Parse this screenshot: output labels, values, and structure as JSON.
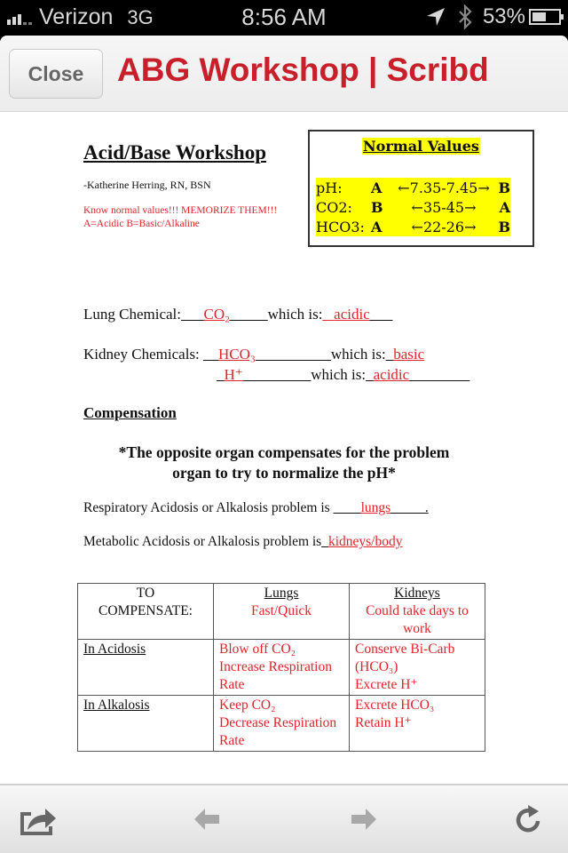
{
  "status_bar": {
    "carrier": "Verizon",
    "network": "3G",
    "time": "8:56 AM",
    "battery_percent": "53%",
    "battery_level": 0.53,
    "icons": [
      "signal-icon",
      "location-icon",
      "bluetooth-icon",
      "battery-icon"
    ]
  },
  "nav": {
    "close_label": "Close",
    "title": "ABG Workshop | Scribd",
    "title_color": "#c8202b"
  },
  "doc": {
    "title": "Acid/Base Workshop",
    "author": "-Katherine Herring, RN, BSN",
    "memo_line1": "Know normal values!!! MEMORIZE THEM!!!",
    "memo_line2": "A=Acidic  B=Basic/Alkaline",
    "normal_values": {
      "title": "Normal Values",
      "rows": [
        {
          "label": "pH:",
          "low": "A",
          "range": "←7.35-7.45→",
          "high": "B"
        },
        {
          "label": "CO2:",
          "low": "B",
          "range": "←35-45→",
          "high": "A"
        },
        {
          "label": "HCO3:",
          "low": "A",
          "range": "←22-26→",
          "high": "B"
        }
      ]
    },
    "lung": {
      "label": "Lung Chemical:",
      "blank_pre": "___",
      "answer": "CO₂",
      "blank_post": "_____",
      "which_is": "which is:",
      "which_blank_pre": "_  ",
      "which_answer": "acidic",
      "which_blank_post": "___"
    },
    "kidney": {
      "label": "Kidney Chemicals: ",
      "blank_pre": "__",
      "answer1": "HCO₃",
      "blank_mid1": "__________",
      "which_is": "which is:",
      "which_pre": "_",
      "answer1_type": "basic",
      "blank_pre2": "_",
      "answer2": "H⁺",
      "blank_mid2": "_________",
      "answer2_type": "acidic",
      "which_post2": "________"
    },
    "compensation_heading": "Compensation",
    "rule_line1": "*The opposite organ compensates for the problem",
    "rule_line2": "organ to try to normalize the pH*",
    "respiratory": {
      "text": "Respiratory Acidosis or Alkalosis problem is ",
      "blank_pre": "____",
      "answer": "lungs",
      "blank_post": "_____."
    },
    "metabolic": {
      "text": "Metabolic Acidosis or Alkalosis problem is",
      "blank_pre": "_",
      "answer": "kidneys/body"
    },
    "table": {
      "header": {
        "col0_line1": "TO",
        "col0_line2": "COMPENSATE:",
        "col1_title": "Lungs",
        "col1_note": "Fast/Quick",
        "col2_title": "Kidneys",
        "col2_note": "Could take days to work"
      },
      "rows": [
        {
          "label": "In Acidosis",
          "lungs": [
            "Blow off CO₂",
            "Increase Respiration Rate"
          ],
          "kidneys": [
            "Conserve Bi-Carb (HCO₃)",
            "Excrete H⁺"
          ]
        },
        {
          "label": "In Alkalosis",
          "lungs": [
            "Keep CO₂",
            "Decrease Respiration Rate"
          ],
          "kidneys": [
            "Excrete HCO₃",
            "Retain H⁺"
          ]
        }
      ]
    }
  },
  "toolbar": {
    "buttons": [
      "share",
      "back",
      "forward",
      "reload"
    ]
  }
}
